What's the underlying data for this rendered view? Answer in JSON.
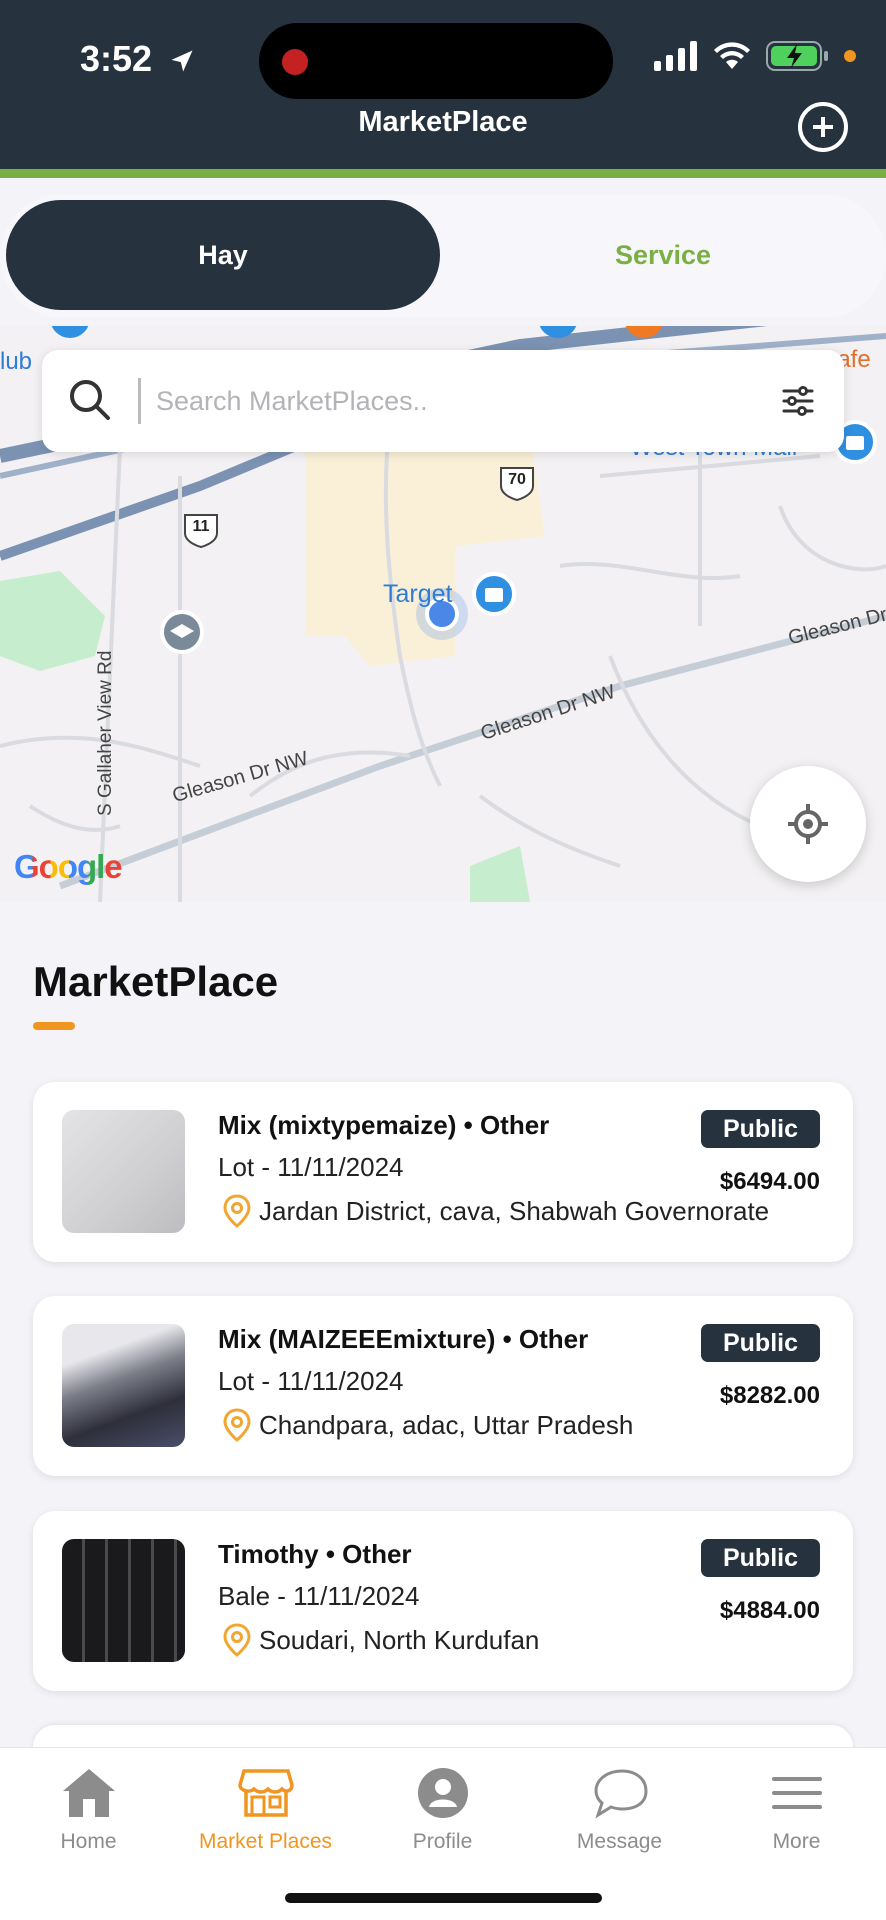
{
  "status_bar": {
    "time": "3:52"
  },
  "header": {
    "title": "MarketPlace"
  },
  "segments": {
    "hay": "Hay",
    "service": "Service"
  },
  "search": {
    "placeholder": "Search MarketPlaces.."
  },
  "map": {
    "labels": {
      "target": "Target",
      "west_town_mall": "West Town Mall",
      "gleason_1": "Gleason Dr NW",
      "gleason_2": "Gleason Dr NW",
      "gleason_3": "Gleason Dr",
      "gallaher": "S Gallaher View Rd",
      "club": "lub",
      "cafe": "Cafe",
      "route_70": "70",
      "route_11": "11"
    },
    "attribution": "Google"
  },
  "section": {
    "title": "MarketPlace"
  },
  "listings": [
    {
      "title": "Mix (mixtypemaize) • Other",
      "subtitle": "Lot - 11/11/2024",
      "location": "Jardan District, cava, Shabwah Governorate",
      "badge": "Public",
      "price": "$6494.00"
    },
    {
      "title": "Mix (MAIZEEEmixture) • Other",
      "subtitle": "Lot - 11/11/2024",
      "location": "Chandpara, adac, Uttar Pradesh",
      "badge": "Public",
      "price": "$8282.00"
    },
    {
      "title": "Timothy • Other",
      "subtitle": "Bale - 11/11/2024",
      "location": "Soudari, North Kurdufan",
      "badge": "Public",
      "price": "$4884.00"
    }
  ],
  "nav": {
    "home": "Home",
    "market_places": "Market Places",
    "profile": "Profile",
    "message": "Message",
    "more": "More"
  },
  "colors": {
    "dark": "#26323d",
    "accent_green": "#7ab043",
    "accent_orange": "#f0951f"
  }
}
